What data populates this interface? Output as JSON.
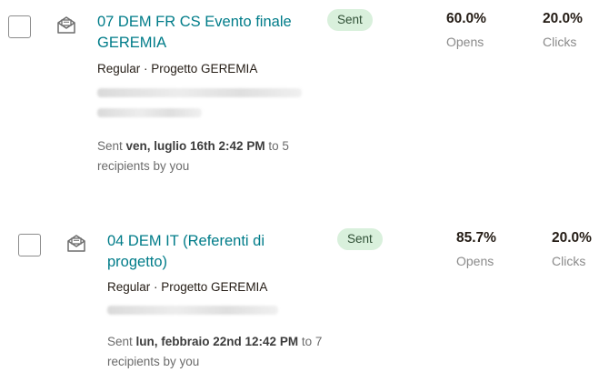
{
  "campaigns": [
    {
      "title": "07 DEM FR CS Evento finale GEREMIA",
      "meta": "Regular · Progetto GEREMIA",
      "status": "Sent",
      "sent_prefix": "Sent ",
      "sent_date": "ven, luglio 16th 2:42 PM",
      "sent_suffix": " to 5 recipients by you",
      "opens_value": "60.0%",
      "opens_label": "Opens",
      "clicks_value": "20.0%",
      "clicks_label": "Clicks"
    },
    {
      "title": "04 DEM IT (Referenti di progetto)",
      "meta": "Regular · Progetto GEREMIA",
      "status": "Sent",
      "sent_prefix": "Sent ",
      "sent_date": "lun, febbraio 22nd 12:42 PM",
      "sent_suffix": " to 7 recipients by you",
      "opens_value": "85.7%",
      "opens_label": "Opens",
      "clicks_value": "20.0%",
      "clicks_label": "Clicks"
    }
  ],
  "icons": {
    "campaign_type": "email-envelope-icon",
    "select": "checkbox"
  },
  "colors": {
    "title_link": "#007c89",
    "badge_bg": "#d9f0dc",
    "badge_text": "#2f4f35"
  }
}
